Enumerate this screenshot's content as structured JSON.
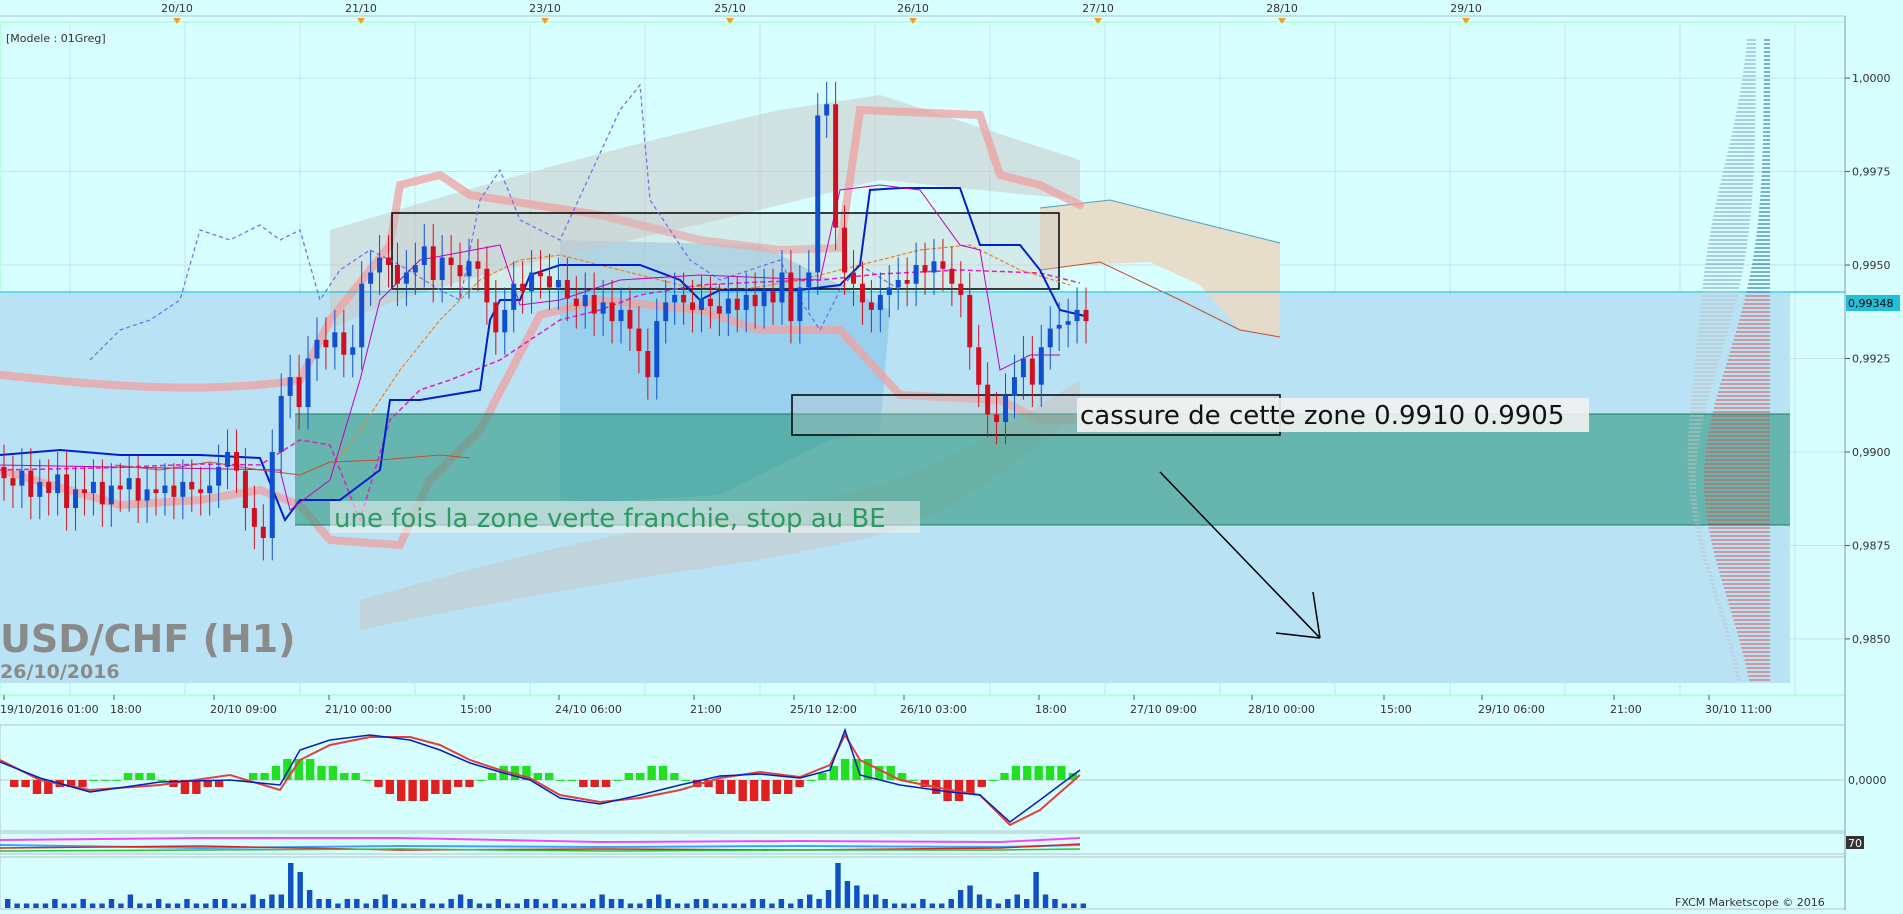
{
  "chart_data": [
    {
      "type": "candlestick",
      "title": "USD/CHF (H1)",
      "subtitle": "26/10/2016",
      "model_label": "[Modele : 01Greg]",
      "current_price": "0,99348",
      "ylim": [
        0.9835,
        1.0015
      ],
      "grid": true,
      "y_ticks": [
        "1,0000",
        "0,9975",
        "0,9950",
        "0,9925",
        "0,9900",
        "0,9875",
        "0,9850"
      ],
      "top_date_labels": [
        "20/10",
        "21/10",
        "23/10",
        "25/10",
        "26/10",
        "27/10",
        "28/10",
        "29/10"
      ],
      "x_tick_labels": [
        "19/10/2016 01:00",
        "18:00",
        "20/10 09:00",
        "21/10 00:00",
        "15:00",
        "24/10 06:00",
        "21:00",
        "25/10 12:00",
        "26/10 03:00",
        "18:00",
        "27/10 09:00",
        "28/10 00:00",
        "15:00",
        "29/10 06:00",
        "21:00",
        "30/10 11:00"
      ],
      "candles_close": [
        0.9893,
        0.9891,
        0.9895,
        0.9888,
        0.9892,
        0.9889,
        0.9894,
        0.9885,
        0.989,
        0.9889,
        0.9892,
        0.9886,
        0.9891,
        0.989,
        0.9893,
        0.9887,
        0.989,
        0.9889,
        0.9891,
        0.9888,
        0.9892,
        0.989,
        0.9889,
        0.9891,
        0.9896,
        0.99,
        0.9895,
        0.9885,
        0.988,
        0.9877,
        0.99,
        0.9915,
        0.992,
        0.9912,
        0.9925,
        0.993,
        0.9928,
        0.9932,
        0.9926,
        0.9928,
        0.9945,
        0.9948,
        0.9952,
        0.995,
        0.9945,
        0.9948,
        0.995,
        0.9955,
        0.9946,
        0.9952,
        0.995,
        0.9947,
        0.9951,
        0.9949,
        0.994,
        0.9932,
        0.9938,
        0.9945,
        0.9943,
        0.9948,
        0.9947,
        0.9944,
        0.9946,
        0.9941,
        0.9939,
        0.9942,
        0.9937,
        0.994,
        0.9935,
        0.9938,
        0.9933,
        0.9927,
        0.992,
        0.9935,
        0.994,
        0.9942,
        0.994,
        0.9938,
        0.9941,
        0.9939,
        0.9937,
        0.9941,
        0.9938,
        0.9942,
        0.9939,
        0.9943,
        0.994,
        0.9948,
        0.9935,
        0.9944,
        0.9948,
        0.999,
        0.9993,
        0.996,
        0.9948,
        0.9945,
        0.994,
        0.9938,
        0.9942,
        0.9944,
        0.9946,
        0.9945,
        0.995,
        0.9948,
        0.9951,
        0.9949,
        0.9945,
        0.9942,
        0.9928,
        0.9918,
        0.991,
        0.9908,
        0.9915,
        0.992,
        0.9925,
        0.9918,
        0.9928,
        0.9933,
        0.9934,
        0.9935,
        0.9938,
        0.9935
      ],
      "annotations": [
        "cassure de cette zone 0.9910 0.9905",
        "une fois la zone verte franchie, stop au BE"
      ],
      "green_zone": [
        0.9876,
        0.9906
      ],
      "box_top": [
        0.9938,
        0.9959
      ],
      "box_bottom": [
        0.99,
        0.9911
      ]
    },
    {
      "type": "line",
      "name": "macd",
      "zero_label": "0,0000",
      "histogram": [
        -1,
        -1,
        -2,
        -2,
        -1,
        -1,
        -1,
        0,
        0,
        0,
        1,
        1,
        1,
        0,
        -1,
        -2,
        -2,
        -1,
        -1,
        0,
        0,
        1,
        1,
        2,
        3,
        3,
        3,
        2,
        2,
        1,
        1,
        0,
        -1,
        -2,
        -3,
        -3,
        -3,
        -2,
        -2,
        -1,
        -1,
        0,
        1,
        2,
        2,
        2,
        1,
        1,
        0,
        0,
        -1,
        -1,
        -1,
        0,
        1,
        1,
        2,
        2,
        1,
        0,
        -1,
        -1,
        -2,
        -2,
        -3,
        -3,
        -3,
        -2,
        -2,
        -1,
        0,
        1,
        2,
        3,
        3,
        3,
        2,
        2,
        1,
        0,
        -1,
        -2,
        -3,
        -3,
        -2,
        -1,
        0,
        1,
        2,
        2,
        2,
        2,
        2,
        1
      ]
    },
    {
      "type": "line",
      "name": "rsi",
      "level_label": "70"
    },
    {
      "type": "bar",
      "name": "volume",
      "footer": "FXCM Marketscope © 2016",
      "values": [
        2,
        1,
        1,
        1,
        1,
        2,
        1,
        1,
        2,
        1,
        1,
        2,
        1,
        3,
        1,
        1,
        2,
        1,
        1,
        2,
        1,
        1,
        2,
        2,
        1,
        1,
        3,
        2,
        3,
        3,
        10,
        8,
        4,
        2,
        2,
        1,
        2,
        2,
        1,
        2,
        3,
        2,
        1,
        1,
        2,
        1,
        1,
        2,
        3,
        2,
        1,
        1,
        2,
        1,
        1,
        2,
        2,
        1,
        2,
        1,
        1,
        1,
        2,
        3,
        2,
        2,
        1,
        1,
        2,
        3,
        2,
        1,
        1,
        2,
        2,
        1,
        1,
        1,
        1,
        2,
        2,
        1,
        2,
        1,
        2,
        3,
        2,
        4,
        10,
        6,
        5,
        3,
        3,
        2,
        1,
        1,
        1,
        2,
        1,
        1,
        2,
        4,
        5,
        3,
        2,
        1,
        2,
        3,
        2,
        8,
        3,
        2,
        1,
        1,
        1
      ]
    }
  ]
}
